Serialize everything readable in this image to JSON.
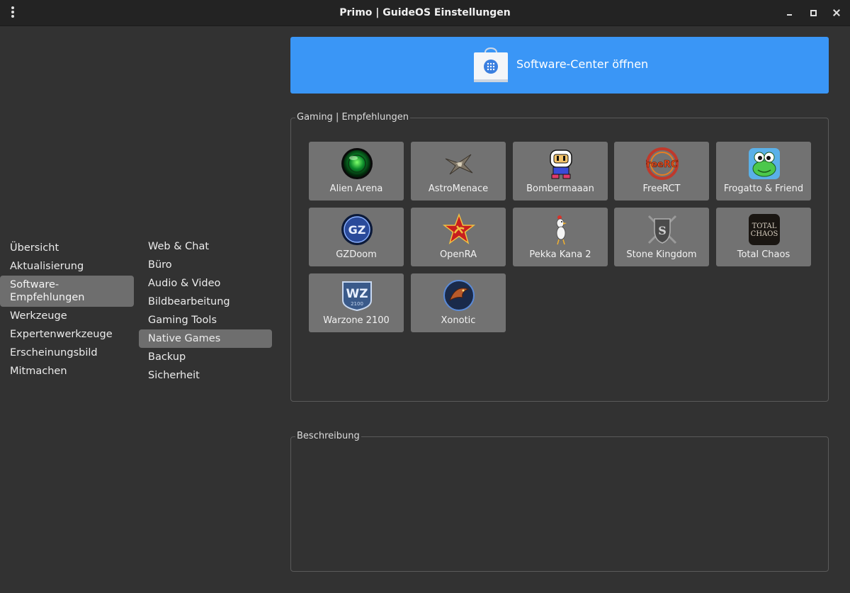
{
  "window": {
    "title": "Primo | GuideOS Einstellungen"
  },
  "nav_main": [
    {
      "label": "Übersicht"
    },
    {
      "label": "Aktualisierung"
    },
    {
      "label": "Software-\nEmpfehlungen"
    },
    {
      "label": "Werkzeuge"
    },
    {
      "label": "Expertenwerkzeuge"
    },
    {
      "label": "Erscheinungsbild"
    },
    {
      "label": "Mitmachen"
    }
  ],
  "nav_main_active": 2,
  "nav_sub": [
    {
      "label": "Web & Chat"
    },
    {
      "label": "Büro"
    },
    {
      "label": "Audio & Video"
    },
    {
      "label": "Bildbearbeitung"
    },
    {
      "label": "Gaming Tools"
    },
    {
      "label": "Native Games"
    },
    {
      "label": "Backup"
    },
    {
      "label": "Sicherheit"
    }
  ],
  "nav_sub_active": 5,
  "software_center": {
    "label": "Software-Center öffnen",
    "icon": "shopping-bag-icon"
  },
  "gaming": {
    "legend": "Gaming | Empfehlungen",
    "tiles": [
      {
        "name": "Alien Arena",
        "icon": "alien-arena-icon"
      },
      {
        "name": "AstroMenace",
        "icon": "astromenace-icon"
      },
      {
        "name": "Bombermaaan",
        "icon": "bombermaaan-icon"
      },
      {
        "name": "FreeRCT",
        "icon": "freerct-icon"
      },
      {
        "name": "Frogatto & Friend",
        "icon": "frogatto-icon"
      },
      {
        "name": "GZDoom",
        "icon": "gzdoom-icon"
      },
      {
        "name": "OpenRA",
        "icon": "openra-icon"
      },
      {
        "name": "Pekka Kana 2",
        "icon": "pekka-kana-icon"
      },
      {
        "name": "Stone Kingdom",
        "icon": "stone-kingdom-icon"
      },
      {
        "name": "Total Chaos",
        "icon": "total-chaos-icon"
      },
      {
        "name": "Warzone 2100",
        "icon": "warzone-icon"
      },
      {
        "name": "Xonotic",
        "icon": "xonotic-icon"
      }
    ]
  },
  "description": {
    "legend": "Beschreibung"
  },
  "colors": {
    "accent": "#3a96f6",
    "tile": "#727272",
    "active": "#6e6e6e",
    "background": "#323232"
  }
}
